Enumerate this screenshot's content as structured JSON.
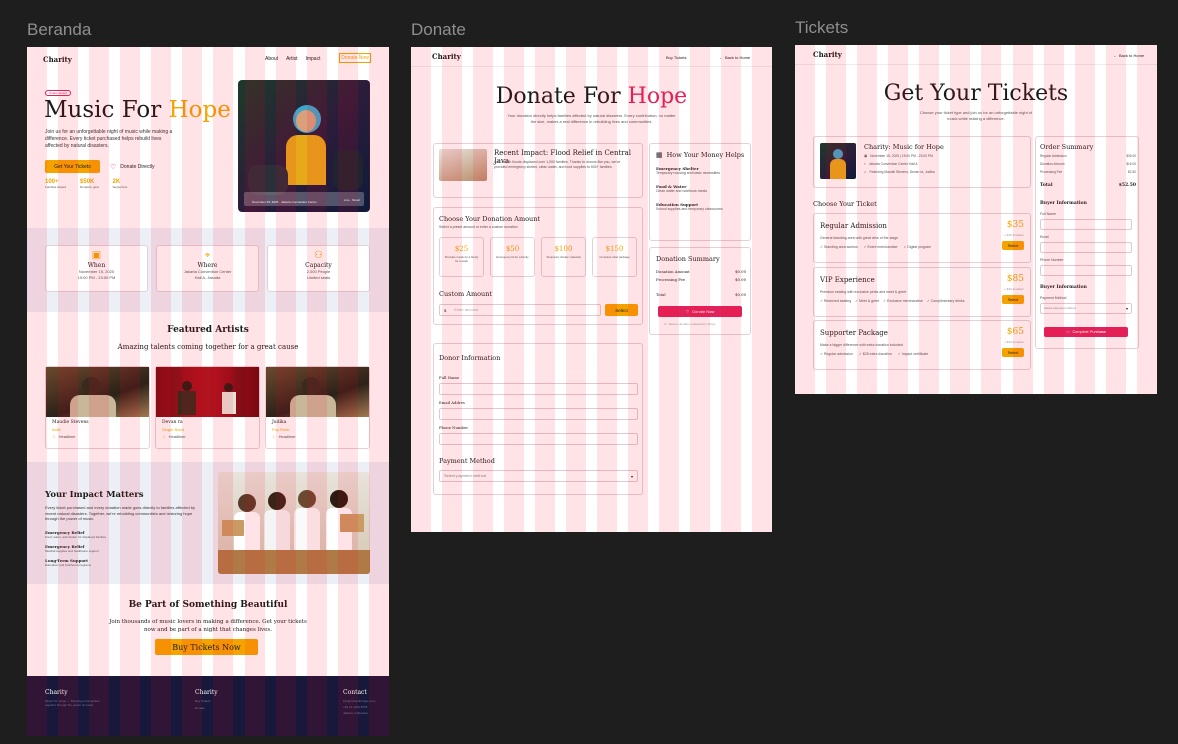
{
  "labels": {
    "beranda": "Beranda",
    "donate": "Donate",
    "tickets": "Tickets"
  },
  "colors": {
    "accent_orange": "#f5a300",
    "accent_pink": "#e0235c",
    "canvas": "#1e1e1e",
    "footer": "#18183a"
  },
  "beranda": {
    "logo": "Charity",
    "nav": [
      "About",
      "Artist",
      "Impact"
    ],
    "nav_cta": "Donate Now",
    "badge": "Charity Event",
    "hero_title_a": "Music For ",
    "hero_title_b": "Hope",
    "hero_text": "Join us for an unforgettable night of music while making a difference. Every ticket purchased helps rebuild lives affected by natural disasters.",
    "btn_tickets": "Get Your Tickets",
    "btn_donate": "Donate Directly",
    "stats": [
      {
        "value": "100+",
        "label": "Families helped"
      },
      {
        "value": "$50K",
        "label": "Donation goal"
      },
      {
        "value": "2K",
        "label": "Supporters"
      }
    ],
    "photo_caption_left": "November 15, 2025 · Jakarta Convention Center",
    "photo_caption_right": "Live · Music",
    "info": [
      {
        "title": "When",
        "line1": "November 15, 2025",
        "line2": "19:00 PM - 23:00 PM",
        "icon": "calendar-icon"
      },
      {
        "title": "Where",
        "line1": "Jakarta Convention Center",
        "line2": "Hall A, Jakarta",
        "icon": "location-icon"
      },
      {
        "title": "Capacity",
        "line1": "2,000 People",
        "line2": "Limited seats",
        "icon": "people-icon"
      }
    ],
    "artists_title": "Featured Artists",
    "artists_sub": "Amazing talents coming together for a great cause",
    "artists": [
      {
        "name": "Maudie Stevens",
        "genre": "Indie",
        "tag": "Headliner"
      },
      {
        "name": "Devan ra",
        "genre": "Singer Band",
        "tag": "Headliner"
      },
      {
        "name": "Judika",
        "genre": "Pop Rock",
        "tag": "Headliner"
      }
    ],
    "impact_title": "Your Impact Matters",
    "impact_text": "Every ticket purchased and every donation made goes directly to families affected by recent natural disasters. Together, we're rebuilding communities and restoring hope through the power of music.",
    "impact_items": [
      {
        "title": "Emergency Relief",
        "text": "Food, water, and shelter for displaced families"
      },
      {
        "title": "Emergency Relief",
        "text": "Medical supplies and healthcare support"
      },
      {
        "title": "Long-Term Support",
        "text": "Education and livelihood programs"
      }
    ],
    "cta_title": "Be Part of Something Beautiful",
    "cta_text": "Join thousands of music lovers in making a difference. Get your tickets now and be part of a night that changes lives.",
    "cta_button": "Buy Tickets Now",
    "footer": [
      {
        "title": "Charity",
        "lines": [
          "Music For Hope — Bringing communities",
          "together through the power of music."
        ]
      },
      {
        "title": "Charity",
        "lines": [
          "Buy Tickets",
          "Donate"
        ]
      },
      {
        "title": "Contact",
        "lines": [
          "info@musicforhope.com",
          "+62 21 1234 5678",
          "Jakarta, Indonesia"
        ]
      }
    ]
  },
  "donate": {
    "logo": "Charity",
    "nav_buy": "Buy Tickets",
    "nav_back": "Back to Home",
    "title_a": "Donate For ",
    "title_b": "Hope",
    "subtitle": "Your donation directly helps families affected by natural disasters. Every contribution, no matter the size, makes a real difference in rebuilding lives and communities.",
    "impact_title": "Recent Impact: Flood Relief in Central Java",
    "impact_text": "Last month floods displaced over 1,000 families. Thanks to donors like you, we've provided emergency shelter, clean water, and food supplies to 500+ families.",
    "helps_title": "How Your Money Helps",
    "helps": [
      {
        "title": "Emergency Shelter",
        "text": "Temporary housing and basic necessities"
      },
      {
        "title": "Food & Water",
        "text": "Clean water and nutritious meals"
      },
      {
        "title": "Education Support",
        "text": "School supplies and temporary classrooms"
      }
    ],
    "amount_title": "Choose Your Donation Amount",
    "amount_sub": "Select a preset amount or enter a custom donation",
    "amounts": [
      {
        "value": "$25",
        "text": "Provides meals for a family for a week"
      },
      {
        "value": "$50",
        "text": "Emergency kit for a family"
      },
      {
        "value": "$100",
        "text": "Temporary shelter materials"
      },
      {
        "value": "$150",
        "text": "Complete relief package"
      }
    ],
    "custom_title": "Custom Amount",
    "custom_placeholder": "Enter amount",
    "custom_button": "Select",
    "summary_title": "Donation Summary",
    "summary_rows": [
      {
        "label": "Donation Amount",
        "value": "$0.00"
      },
      {
        "label": "Processing Fee",
        "value": "$0.00"
      },
      {
        "label": "Total",
        "value": "$0.00"
      }
    ],
    "donate_button": "Donate Now",
    "secure_text": "Secure donation powered by Stripe",
    "donor_title": "Donor Information",
    "fields": [
      "Full Name",
      "Email Addres",
      "Phone Number"
    ],
    "payment_title": "Payment Method",
    "payment_placeholder": "Select payment method"
  },
  "tickets": {
    "logo": "Charity",
    "nav_back": "Back to Home",
    "title": "Get Your Tickets",
    "subtitle": "Choose your ticket type and join us for an unforgettable night of music while making a difference.",
    "event_title": "Charity: Music for Hope",
    "event_lines": [
      "November 15, 2025 | 19:00 PM - 23:00 PM",
      "Jakarta Convention Center Hall A",
      "Featuring Maudie Stevens, Devan ra, Judika"
    ],
    "choose_title": "Choose Your Ticket",
    "ticket_types": [
      {
        "name": "Regular Admission",
        "price": "$35",
        "note": "+ $15 donation",
        "desc": "General standing area with great view of the stage",
        "features": [
          "Standing area access",
          "Event merchandise",
          "Digital program"
        ],
        "button": "Select"
      },
      {
        "name": "VIP Experience",
        "price": "$85",
        "note": "+ $40 donation",
        "desc": "Premium seating with exclusive perks and meet & greet",
        "features": [
          "Reserved seating",
          "Meet & greet",
          "Exclusive merchandise",
          "Complimentary drinks"
        ],
        "button": "Select"
      },
      {
        "name": "Supporter Package",
        "price": "$65",
        "note": "+ $30 donation",
        "desc": "Make a bigger difference with extra donation included",
        "features": [
          "Regular admission",
          "$25 extra donation",
          "Impact certificate"
        ],
        "button": "Select"
      }
    ],
    "order_title": "Order Summary",
    "order_rows": [
      {
        "label": "Regular Admission",
        "value": "$35.00"
      },
      {
        "label": "Donation Amount",
        "value": "$15.00"
      },
      {
        "label": "Processing Fee",
        "value": "$2.50"
      }
    ],
    "order_total_label": "Total",
    "order_total": "$52.50",
    "buyer_title": "Buyer Information",
    "buyer_fields": [
      "Full Name",
      "Email",
      "Phone Number"
    ],
    "buyer_title2": "Buyer Information",
    "payment_label": "Payment Method",
    "payment_placeholder": "Select payment method",
    "purchase_button": "Complete Purchase"
  }
}
